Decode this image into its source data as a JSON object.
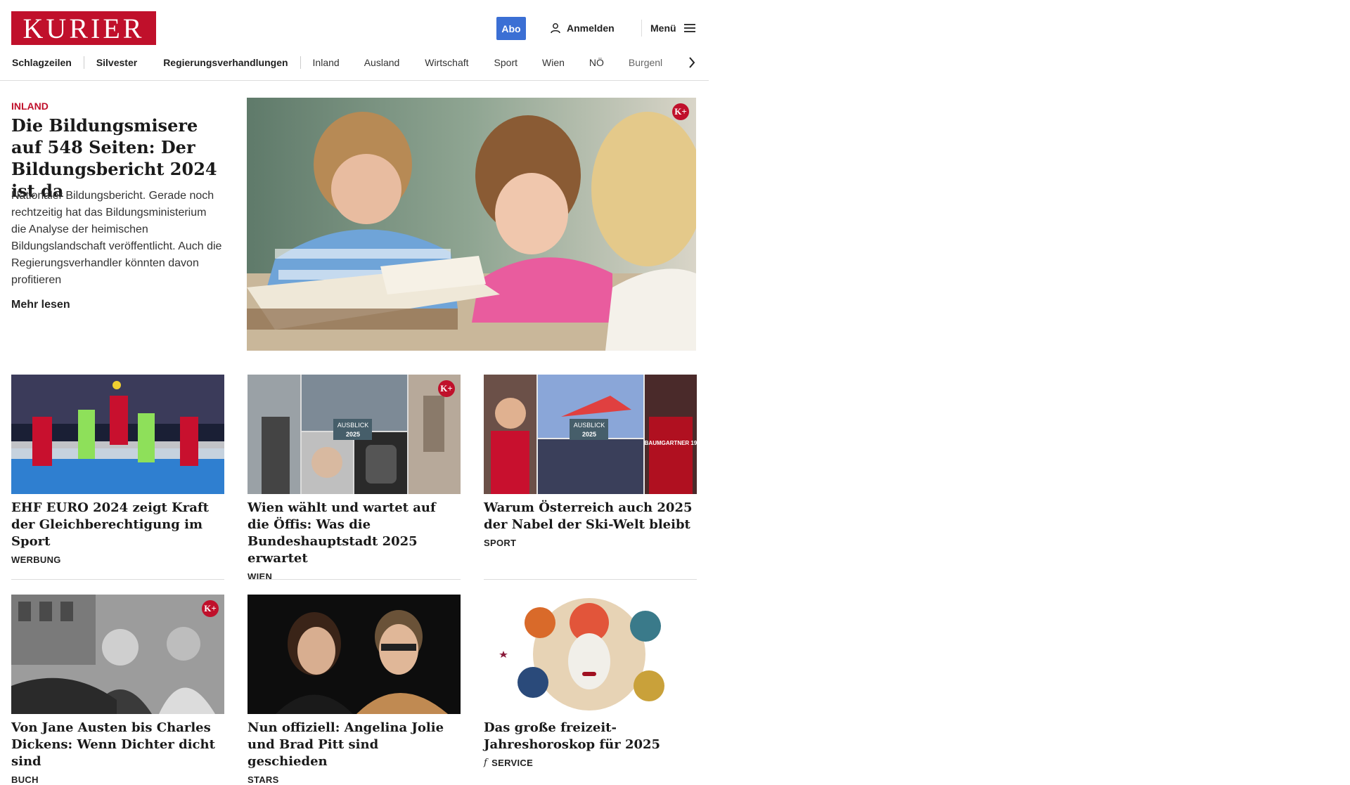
{
  "header": {
    "logo": "KURIER",
    "abo_label": "Abo",
    "login_label": "Anmelden",
    "menu_label": "Menü"
  },
  "nav": {
    "items": [
      "Schlagzeilen",
      "Silvester",
      "Regierungsverhandlungen",
      "Inland",
      "Ausland",
      "Wirtschaft",
      "Sport",
      "Wien",
      "NÖ",
      "Burgenl"
    ]
  },
  "lead": {
    "category": "INLAND",
    "title": "Die Bildungsmisere auf 548 Seiten: Der Bildungs­bericht 2024 ist da",
    "teaser": "Nationaler Bildungsbericht. Gerade noch rechtzeitig hat das Bildungsministerium die Analyse der heimischen Bildungslandschaft veröffentlicht. Auch die Regierungsverhandler könnten davon profitieren",
    "more_label": "Mehr lesen",
    "premium_badge": "K+"
  },
  "cards": [
    {
      "title": "EHF EURO 2024 zeigt Kraft der Gleichberechtigung im Sport",
      "category": "WERBUNG"
    },
    {
      "title": "Wien wählt und wartet auf die Öf­fis: Was die Bundeshauptstadt 2025 erwartet",
      "category": "WIEN",
      "overlay_a": "AUSBLICK",
      "overlay_b": "2025",
      "premium_badge": "K+"
    },
    {
      "title": "Warum Österreich auch 2025 der Nabel der Ski-Welt bleibt",
      "category": "SPORT",
      "overlay_a": "AUSBLICK",
      "overlay_b": "2025",
      "image_text": "BAUMGARTNER 19"
    },
    {
      "title": "Von Jane Austen bis Charles Di­ckens: Wenn Dichter dicht sind",
      "category": "BUCH",
      "premium_badge": "K+"
    },
    {
      "title": "Nun offiziell: Angelina Jolie und Brad Pitt sind geschieden",
      "category": "STARS"
    },
    {
      "title": "Das große freizeit-Jahreshoroskop für 2025",
      "category": "SERVICE",
      "category_icon": "f"
    }
  ],
  "colors": {
    "brand": "#c0102b",
    "abo": "#3b6fd4"
  },
  "icons": [
    "user-icon",
    "hamburger-icon",
    "chevron-right-icon",
    "kplus-badge-icon"
  ]
}
